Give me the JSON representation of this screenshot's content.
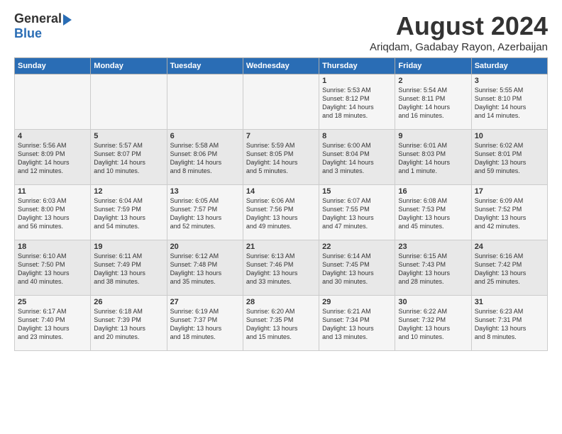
{
  "logo": {
    "general": "General",
    "blue": "Blue"
  },
  "title": "August 2024",
  "location": "Ariqdam, Gadabay Rayon, Azerbaijan",
  "days_of_week": [
    "Sunday",
    "Monday",
    "Tuesday",
    "Wednesday",
    "Thursday",
    "Friday",
    "Saturday"
  ],
  "weeks": [
    [
      {
        "day": "",
        "info": ""
      },
      {
        "day": "",
        "info": ""
      },
      {
        "day": "",
        "info": ""
      },
      {
        "day": "",
        "info": ""
      },
      {
        "day": "1",
        "info": "Sunrise: 5:53 AM\nSunset: 8:12 PM\nDaylight: 14 hours\nand 18 minutes."
      },
      {
        "day": "2",
        "info": "Sunrise: 5:54 AM\nSunset: 8:11 PM\nDaylight: 14 hours\nand 16 minutes."
      },
      {
        "day": "3",
        "info": "Sunrise: 5:55 AM\nSunset: 8:10 PM\nDaylight: 14 hours\nand 14 minutes."
      }
    ],
    [
      {
        "day": "4",
        "info": "Sunrise: 5:56 AM\nSunset: 8:09 PM\nDaylight: 14 hours\nand 12 minutes."
      },
      {
        "day": "5",
        "info": "Sunrise: 5:57 AM\nSunset: 8:07 PM\nDaylight: 14 hours\nand 10 minutes."
      },
      {
        "day": "6",
        "info": "Sunrise: 5:58 AM\nSunset: 8:06 PM\nDaylight: 14 hours\nand 8 minutes."
      },
      {
        "day": "7",
        "info": "Sunrise: 5:59 AM\nSunset: 8:05 PM\nDaylight: 14 hours\nand 5 minutes."
      },
      {
        "day": "8",
        "info": "Sunrise: 6:00 AM\nSunset: 8:04 PM\nDaylight: 14 hours\nand 3 minutes."
      },
      {
        "day": "9",
        "info": "Sunrise: 6:01 AM\nSunset: 8:03 PM\nDaylight: 14 hours\nand 1 minute."
      },
      {
        "day": "10",
        "info": "Sunrise: 6:02 AM\nSunset: 8:01 PM\nDaylight: 13 hours\nand 59 minutes."
      }
    ],
    [
      {
        "day": "11",
        "info": "Sunrise: 6:03 AM\nSunset: 8:00 PM\nDaylight: 13 hours\nand 56 minutes."
      },
      {
        "day": "12",
        "info": "Sunrise: 6:04 AM\nSunset: 7:59 PM\nDaylight: 13 hours\nand 54 minutes."
      },
      {
        "day": "13",
        "info": "Sunrise: 6:05 AM\nSunset: 7:57 PM\nDaylight: 13 hours\nand 52 minutes."
      },
      {
        "day": "14",
        "info": "Sunrise: 6:06 AM\nSunset: 7:56 PM\nDaylight: 13 hours\nand 49 minutes."
      },
      {
        "day": "15",
        "info": "Sunrise: 6:07 AM\nSunset: 7:55 PM\nDaylight: 13 hours\nand 47 minutes."
      },
      {
        "day": "16",
        "info": "Sunrise: 6:08 AM\nSunset: 7:53 PM\nDaylight: 13 hours\nand 45 minutes."
      },
      {
        "day": "17",
        "info": "Sunrise: 6:09 AM\nSunset: 7:52 PM\nDaylight: 13 hours\nand 42 minutes."
      }
    ],
    [
      {
        "day": "18",
        "info": "Sunrise: 6:10 AM\nSunset: 7:50 PM\nDaylight: 13 hours\nand 40 minutes."
      },
      {
        "day": "19",
        "info": "Sunrise: 6:11 AM\nSunset: 7:49 PM\nDaylight: 13 hours\nand 38 minutes."
      },
      {
        "day": "20",
        "info": "Sunrise: 6:12 AM\nSunset: 7:48 PM\nDaylight: 13 hours\nand 35 minutes."
      },
      {
        "day": "21",
        "info": "Sunrise: 6:13 AM\nSunset: 7:46 PM\nDaylight: 13 hours\nand 33 minutes."
      },
      {
        "day": "22",
        "info": "Sunrise: 6:14 AM\nSunset: 7:45 PM\nDaylight: 13 hours\nand 30 minutes."
      },
      {
        "day": "23",
        "info": "Sunrise: 6:15 AM\nSunset: 7:43 PM\nDaylight: 13 hours\nand 28 minutes."
      },
      {
        "day": "24",
        "info": "Sunrise: 6:16 AM\nSunset: 7:42 PM\nDaylight: 13 hours\nand 25 minutes."
      }
    ],
    [
      {
        "day": "25",
        "info": "Sunrise: 6:17 AM\nSunset: 7:40 PM\nDaylight: 13 hours\nand 23 minutes."
      },
      {
        "day": "26",
        "info": "Sunrise: 6:18 AM\nSunset: 7:39 PM\nDaylight: 13 hours\nand 20 minutes."
      },
      {
        "day": "27",
        "info": "Sunrise: 6:19 AM\nSunset: 7:37 PM\nDaylight: 13 hours\nand 18 minutes."
      },
      {
        "day": "28",
        "info": "Sunrise: 6:20 AM\nSunset: 7:35 PM\nDaylight: 13 hours\nand 15 minutes."
      },
      {
        "day": "29",
        "info": "Sunrise: 6:21 AM\nSunset: 7:34 PM\nDaylight: 13 hours\nand 13 minutes."
      },
      {
        "day": "30",
        "info": "Sunrise: 6:22 AM\nSunset: 7:32 PM\nDaylight: 13 hours\nand 10 minutes."
      },
      {
        "day": "31",
        "info": "Sunrise: 6:23 AM\nSunset: 7:31 PM\nDaylight: 13 hours\nand 8 minutes."
      }
    ]
  ]
}
